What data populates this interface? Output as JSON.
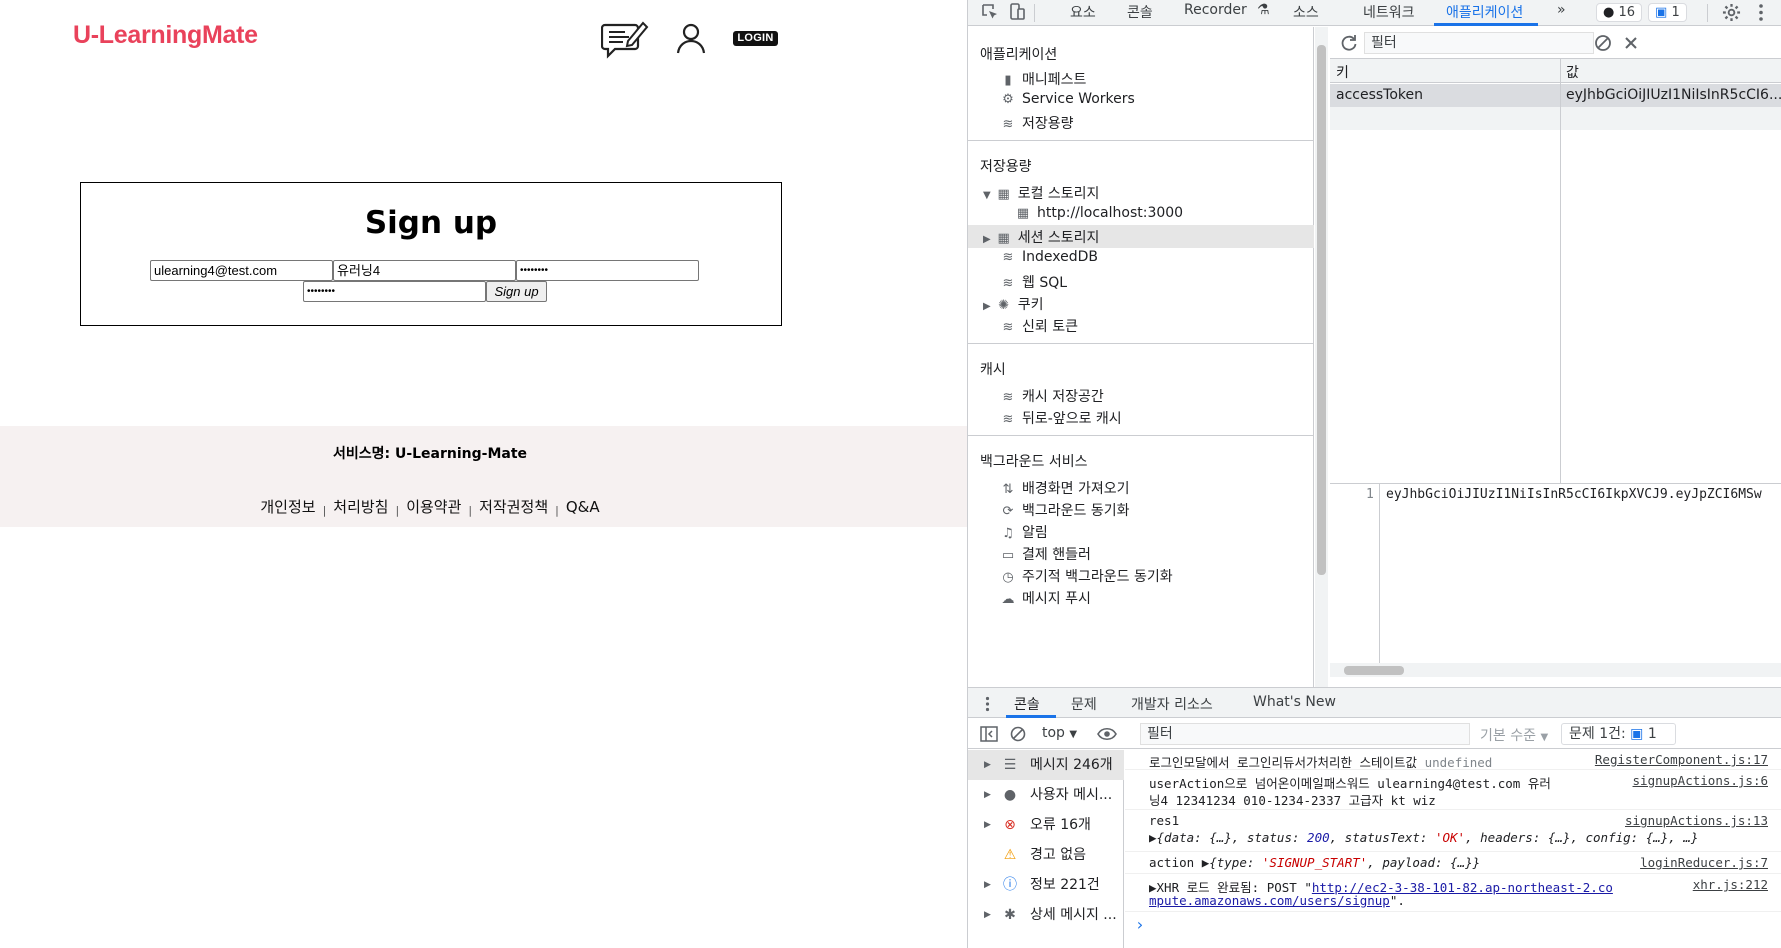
{
  "site": {
    "logo": "U-LearningMate",
    "login_label": "LOGIN",
    "signup_title": "Sign up",
    "fields": {
      "email": "ulearning4@test.com",
      "name": "유러닝4",
      "password": "••••••••",
      "password_confirm": "••••••••"
    },
    "signup_button": "Sign up",
    "footer": {
      "service_name": "서비스명: U-Learning-Mate",
      "links": [
        "개인정보",
        "처리방침",
        "이용약관",
        "저작권정책",
        "Q&A"
      ],
      "separator": "|"
    }
  },
  "devtools": {
    "tabs": [
      "요소",
      "콘솔",
      "Recorder",
      "소스",
      "네트워크",
      "애플리케이션",
      "»"
    ],
    "active_tab": "애플리케이션",
    "recorder_flask": "⚗",
    "badges": {
      "errors": "16",
      "messages": "1"
    },
    "sidebar": {
      "app_section": "애플리케이션",
      "app_items": [
        "매니페스트",
        "Service Workers",
        "저장용량"
      ],
      "storage_section": "저장용량",
      "storage_items": [
        "로컬 스토리지",
        "http://localhost:3000",
        "세션 스토리지",
        "IndexedDB",
        "웹 SQL",
        "쿠키",
        "신뢰 토큰"
      ],
      "cache_section": "캐시",
      "cache_items": [
        "캐시 저장공간",
        "뒤로-앞으로 캐시"
      ],
      "bg_section": "백그라운드 서비스",
      "bg_items": [
        "배경화면 가져오기",
        "백그라운드 동기화",
        "알림",
        "결제 핸들러",
        "주기적 백그라운드 동기화",
        "메시지 푸시"
      ]
    },
    "storage_table": {
      "filter_placeholder": "필터",
      "col_key": "키",
      "col_value": "값",
      "rows": [
        {
          "key": "accessToken",
          "value": "eyJhbGciOiJIUzI1NiIsInR5cCI6..."
        }
      ],
      "preview_line_no": "1",
      "preview_value": "eyJhbGciOiJIUzI1NiIsInR5cCI6IkpXVCJ9.eyJpZCI6MSw"
    },
    "drawer": {
      "tabs": [
        "콘솔",
        "문제",
        "개발자 리소스",
        "What's New"
      ],
      "context": "top",
      "filter_placeholder": "필터",
      "level": "기본 수준",
      "issues": "문제 1건:",
      "issues_count": "1",
      "sidebar": [
        {
          "label": "메시지 246개",
          "icon": "list-icon"
        },
        {
          "label": "사용자 메시...",
          "icon": "user-icon"
        },
        {
          "label": "오류 16개",
          "icon": "error-icon"
        },
        {
          "label": "경고 없음",
          "icon": "warning-icon"
        },
        {
          "label": "정보 221건",
          "icon": "info-icon"
        },
        {
          "label": "상세 메시지 ...",
          "icon": "bug-icon"
        }
      ],
      "messages": {
        "m1_text": "로그인모달에서 로그인리듀서가처리한 스테이트값",
        "m1_val": "undefined",
        "m1_src": "RegisterComponent.js:17",
        "m2_line1": "userAction으로 넘어온이메일패스워드 ulearning4@test.com 유러",
        "m2_line2": "닝4 12341234 010-1234-2337 고급자 kt wiz",
        "m2_src": "signupActions.js:6",
        "m3_text": "res1",
        "m3_src": "signupActions.js:13",
        "m3_obj_a": "▶{data: {…}, status: ",
        "m3_status": "200",
        "m3_obj_b": ", statusText: ",
        "m3_statustext": "'OK'",
        "m3_obj_c": ", headers: {…}, config: {…}, …}",
        "m4_text": "action",
        "m4_obj_a": "▶{type: ",
        "m4_type": "'SIGNUP_START'",
        "m4_obj_b": ", payload: {…}}",
        "m4_src": "loginReducer.js:7",
        "m5_text": "▶XHR 로드 완료됨: POST \"",
        "m5_url1": "http://ec2-3-38-101-82.ap-northeast-2.co",
        "m5_url2": "mpute.amazonaws.com/users/signup",
        "m5_end": "\".",
        "m5_src": "xhr.js:212",
        "prompt": "›"
      }
    }
  }
}
